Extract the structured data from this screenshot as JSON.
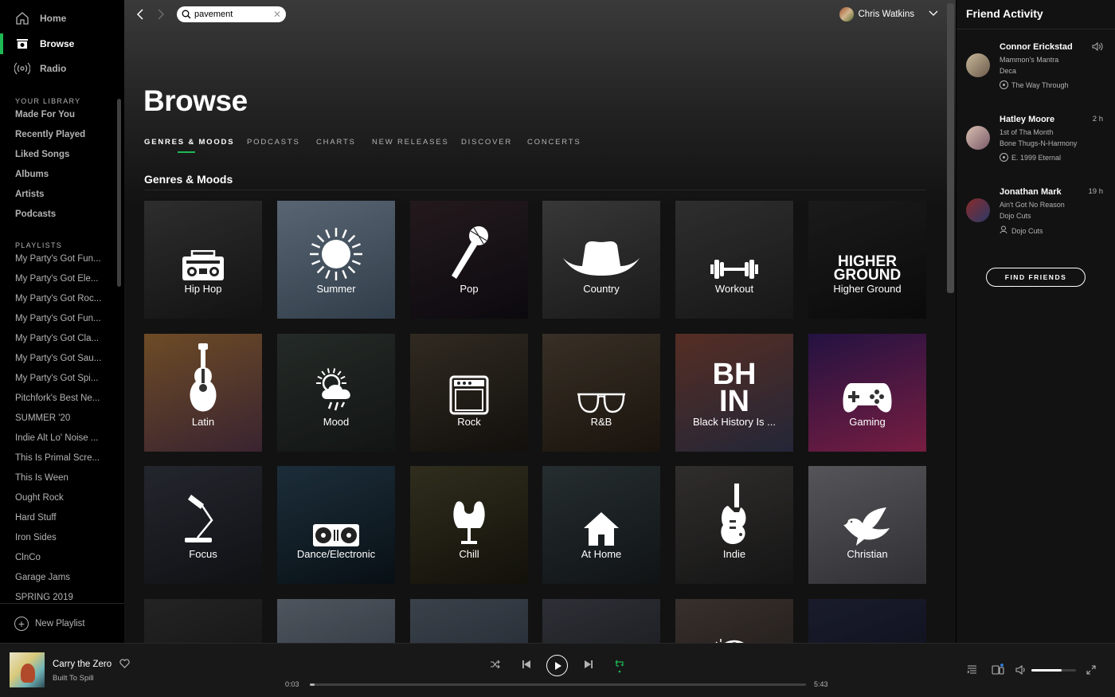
{
  "sidebar": {
    "nav": [
      {
        "label": "Home",
        "icon": "home-icon",
        "active": false
      },
      {
        "label": "Browse",
        "icon": "browse-icon",
        "active": true
      },
      {
        "label": "Radio",
        "icon": "radio-icon",
        "active": false
      }
    ],
    "library_title": "YOUR LIBRARY",
    "library": [
      "Made For You",
      "Recently Played",
      "Liked Songs",
      "Albums",
      "Artists",
      "Podcasts"
    ],
    "playlists_title": "PLAYLISTS",
    "playlists": [
      "My Party's Got Fun...",
      "My Party's Got Ele...",
      "My Party's Got Roc...",
      "My Party's Got Fun...",
      "My Party's Got Cla...",
      "My Party's Got Sau...",
      "My Party's Got Spi...",
      "Pitchfork's Best Ne...",
      "SUMMER '20",
      "Indie Alt Lo' Noise ...",
      "This Is Primal Scre...",
      "This Is Ween",
      "Ought Rock",
      "Hard Stuff",
      "Iron Sides",
      "ClnCo",
      "Garage Jams",
      "SPRING 2019"
    ],
    "new_playlist": "New Playlist"
  },
  "topbar": {
    "search_value": "pavement",
    "user_name": "Chris Watkins"
  },
  "main": {
    "title": "Browse",
    "tabs": [
      {
        "label": "GENRES & MOODS",
        "active": true
      },
      {
        "label": "PODCASTS",
        "active": false
      },
      {
        "label": "CHARTS",
        "active": false
      },
      {
        "label": "NEW RELEASES",
        "active": false
      },
      {
        "label": "DISCOVER",
        "active": false
      },
      {
        "label": "CONCERTS",
        "active": false
      }
    ],
    "section_title": "Genres & Moods",
    "tiles": [
      {
        "label": "Hip Hop",
        "icon": "boombox-icon",
        "bg": [
          "#4a4a4a",
          "#1e1e1e"
        ]
      },
      {
        "label": "Summer",
        "icon": "sun-icon",
        "bg": [
          "#8fa3b8",
          "#4f6478"
        ]
      },
      {
        "label": "Pop",
        "icon": "microphone-icon",
        "bg": [
          "#3a2a30",
          "#141018"
        ]
      },
      {
        "label": "Country",
        "icon": "cowboy-hat-icon",
        "bg": [
          "#5a5a5a",
          "#2a2a2a"
        ]
      },
      {
        "label": "Workout",
        "icon": "dumbbell-icon",
        "bg": [
          "#4b4b4b",
          "#262626"
        ]
      },
      {
        "label": "Higher Ground",
        "icon": "higher-ground-logo-icon",
        "logo_lines": [
          "HIGHER",
          "GROUND"
        ],
        "bg": [
          "#2c2c2c",
          "#111"
        ]
      },
      {
        "label": "Latin",
        "icon": "guitar-icon",
        "bg": [
          "#b07a3e",
          "#5e3a4e"
        ]
      },
      {
        "label": "Mood",
        "icon": "weather-icon",
        "bg": [
          "#3b4540",
          "#1d2220"
        ]
      },
      {
        "label": "Rock",
        "icon": "amplifier-icon",
        "bg": [
          "#4e4436",
          "#1e1a15"
        ]
      },
      {
        "label": "R&B",
        "icon": "sunglasses-icon",
        "bg": [
          "#5a4e3e",
          "#2a2016"
        ]
      },
      {
        "label": "Black History Is ...",
        "icon": "bhin-logo-icon",
        "logo_lines": [
          "BH",
          "IN"
        ],
        "bg": [
          "#8a4a3a",
          "#3a3e5a"
        ]
      },
      {
        "label": "Gaming",
        "icon": "gamepad-icon",
        "bg": [
          "#3a1e6a",
          "#c0306a"
        ]
      },
      {
        "label": "Focus",
        "icon": "desk-lamp-icon",
        "bg": [
          "#3a3e4a",
          "#1a1c22"
        ]
      },
      {
        "label": "Dance/Electronic",
        "icon": "turntable-icon",
        "bg": [
          "#2e4a5e",
          "#0e1a22"
        ]
      },
      {
        "label": "Chill",
        "icon": "egg-chair-icon",
        "bg": [
          "#4e4a30",
          "#1e1c10"
        ]
      },
      {
        "label": "At Home",
        "icon": "house-icon",
        "bg": [
          "#3e4a4e",
          "#1a2022"
        ]
      },
      {
        "label": "Indie",
        "icon": "electric-guitar-icon",
        "bg": [
          "#4e4a48",
          "#222"
        ]
      },
      {
        "label": "Christian",
        "icon": "dove-icon",
        "bg": [
          "#8a8a90",
          "#4e4e55"
        ]
      },
      {
        "label": "",
        "icon": "calendar-icon",
        "bg": [
          "#3a3a3a",
          "#1a1a1a"
        ]
      },
      {
        "label": "",
        "icon": "lightning-icon",
        "bg": [
          "#7e8a98",
          "#3e4a58"
        ]
      },
      {
        "label": "",
        "icon": "heartbeat-icon",
        "bg": [
          "#5e6a78",
          "#2e3a48"
        ]
      },
      {
        "label": "",
        "icon": "record-player-icon",
        "bg": [
          "#4a4e58",
          "#1e2028"
        ]
      },
      {
        "label": "",
        "icon": "globe-icon",
        "bg": [
          "#5a4e48",
          "#2a2220"
        ]
      },
      {
        "label": "",
        "icon": "moon-stars-icon",
        "bg": [
          "#2a2e48",
          "#121426"
        ]
      }
    ]
  },
  "friends": {
    "title": "Friend Activity",
    "list": [
      {
        "name": "Connor Erickstad",
        "time": "",
        "track": "Mammon's Mantra",
        "artist": "Deca",
        "context": "The Way Through",
        "context_icon": "album-icon",
        "avatar": [
          "#c8b89a",
          "#6a5a4a"
        ],
        "playing": true
      },
      {
        "name": "Hatley Moore",
        "time": "2 h",
        "track": "1st of Tha Month",
        "artist": "Bone Thugs-N-Harmony",
        "context": "E. 1999 Eternal",
        "context_icon": "album-icon",
        "avatar": [
          "#d8c0b0",
          "#7a5a6a"
        ],
        "playing": false
      },
      {
        "name": "Jonathan Mark",
        "time": "19 h",
        "track": "Ain't Got No Reason",
        "artist": "Dojo Cuts",
        "context": "Dojo Cuts",
        "context_icon": "artist-icon",
        "avatar": [
          "#8a2a2a",
          "#2a3a6a"
        ],
        "playing": false
      }
    ],
    "find_button": "FIND FRIENDS"
  },
  "player": {
    "title": "Carry the Zero",
    "artist": "Built To Spill",
    "current_time": "0:03",
    "total_time": "5:43",
    "progress_fraction": 0.009,
    "volume_fraction": 0.68,
    "accent": "#1db954"
  }
}
